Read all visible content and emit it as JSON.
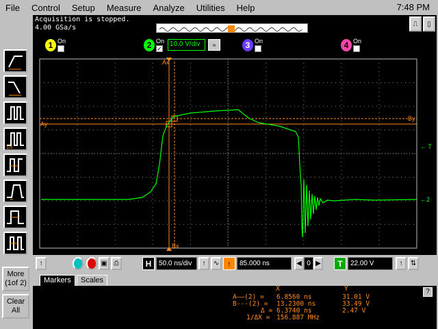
{
  "menu": {
    "items": [
      "File",
      "Control",
      "Setup",
      "Measure",
      "Analyze",
      "Utilities",
      "Help"
    ],
    "time": "7:48 PM"
  },
  "status": {
    "line1": "Acquisition is stopped.",
    "line2": "4.00 GSa/s"
  },
  "channels": [
    {
      "num": "1",
      "label": "On",
      "checked": false,
      "color": "#ffff00"
    },
    {
      "num": "2",
      "label": "On",
      "checked": true,
      "color": "#00ff00",
      "scale": "10.0 V/div"
    },
    {
      "num": "3",
      "label": "On",
      "checked": false,
      "color": "#6a3cff"
    },
    {
      "num": "4",
      "label": "On",
      "checked": false,
      "color": "#ff44aa"
    }
  ],
  "left_toolbar": {
    "more_label": "More\n(1of 2)",
    "clear_label": "Clear\nAll"
  },
  "screen_labels": {
    "ax": "Ax",
    "bx": "Bx",
    "ay": "Ay",
    "by": "By",
    "trig": "T",
    "chan_ref": "2"
  },
  "controls": {
    "h_letter": "H",
    "timebase": "50.0 ns/div",
    "delay": "85.000 ns",
    "delay_ref": "0",
    "t_letter": "T",
    "trigger_level": "22.00 V"
  },
  "tabs": {
    "markers": "Markers",
    "scales": "Scales"
  },
  "markers": {
    "hdr_x": "X",
    "hdr_y": "Y",
    "a_label": "A——(2) =",
    "a_x": "6.8560 ns",
    "a_y": "31.01 V",
    "b_label": "B---(2) =",
    "b_x": "13.2300 ns",
    "b_y": "33.49 V",
    "d_label": "Δ =",
    "d_x": "6.3740 ns",
    "d_y": "2.47 V",
    "inv_label": "1/ΔX =",
    "inv_x": "156.887 MHz",
    "help": "?"
  },
  "colors": {
    "trace": "#00ff00",
    "marker": "#ff8c1a",
    "grid": "#c0c0c0"
  }
}
